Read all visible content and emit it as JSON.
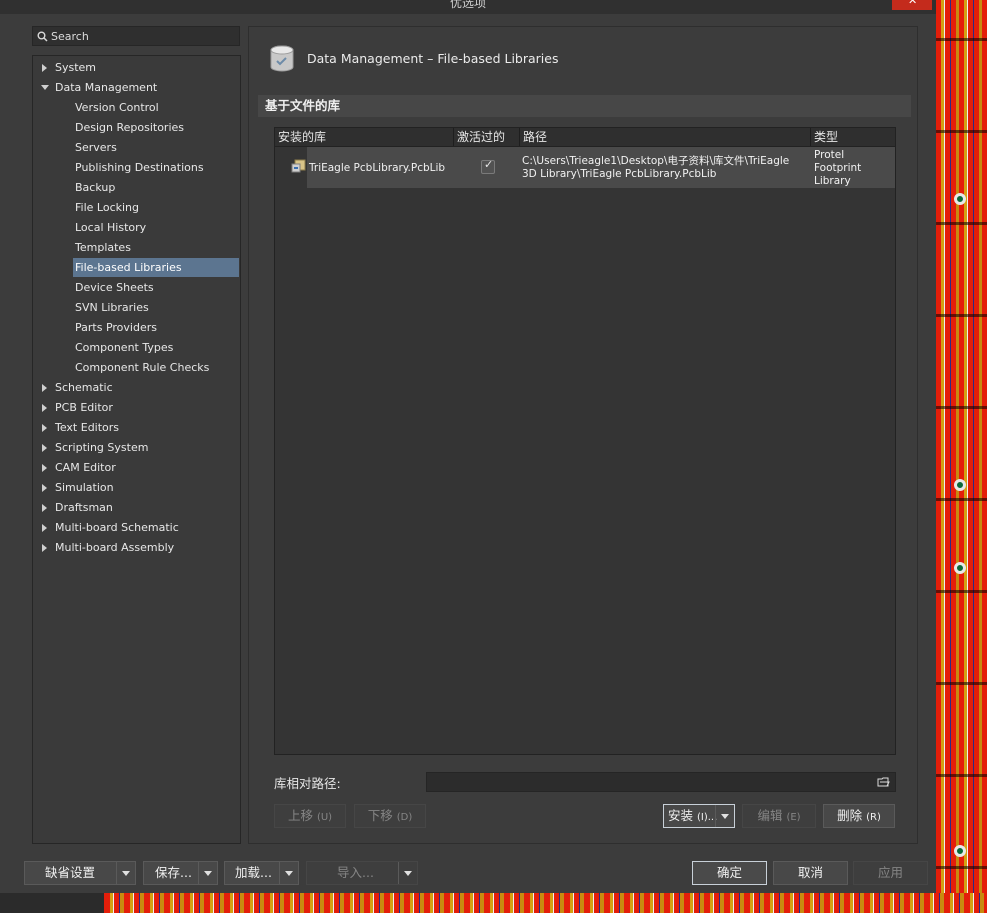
{
  "window": {
    "title": "优选项"
  },
  "search": {
    "placeholder": "Search"
  },
  "sidebar": {
    "items": [
      {
        "label": "System",
        "level": 0,
        "expanded": false,
        "selected": false
      },
      {
        "label": "Data Management",
        "level": 0,
        "expanded": true,
        "selected": false
      },
      {
        "label": "Version Control",
        "level": 1,
        "selected": false
      },
      {
        "label": "Design Repositories",
        "level": 1,
        "selected": false
      },
      {
        "label": "Servers",
        "level": 1,
        "selected": false
      },
      {
        "label": "Publishing Destinations",
        "level": 1,
        "selected": false
      },
      {
        "label": "Backup",
        "level": 1,
        "selected": false
      },
      {
        "label": "File Locking",
        "level": 1,
        "selected": false
      },
      {
        "label": "Local History",
        "level": 1,
        "selected": false
      },
      {
        "label": "Templates",
        "level": 1,
        "selected": false
      },
      {
        "label": "File-based Libraries",
        "level": 1,
        "selected": true
      },
      {
        "label": "Device Sheets",
        "level": 1,
        "selected": false
      },
      {
        "label": "SVN Libraries",
        "level": 1,
        "selected": false
      },
      {
        "label": "Parts Providers",
        "level": 1,
        "selected": false
      },
      {
        "label": "Component Types",
        "level": 1,
        "selected": false
      },
      {
        "label": "Component Rule Checks",
        "level": 1,
        "selected": false
      },
      {
        "label": "Schematic",
        "level": 0,
        "expanded": false,
        "selected": false
      },
      {
        "label": "PCB Editor",
        "level": 0,
        "expanded": false,
        "selected": false
      },
      {
        "label": "Text Editors",
        "level": 0,
        "expanded": false,
        "selected": false
      },
      {
        "label": "Scripting System",
        "level": 0,
        "expanded": false,
        "selected": false
      },
      {
        "label": "CAM Editor",
        "level": 0,
        "expanded": false,
        "selected": false
      },
      {
        "label": "Simulation",
        "level": 0,
        "expanded": false,
        "selected": false
      },
      {
        "label": "Draftsman",
        "level": 0,
        "expanded": false,
        "selected": false
      },
      {
        "label": "Multi-board Schematic",
        "level": 0,
        "expanded": false,
        "selected": false
      },
      {
        "label": "Multi-board Assembly",
        "level": 0,
        "expanded": false,
        "selected": false
      }
    ]
  },
  "page": {
    "title": "Data Management – File-based Libraries",
    "section": "基于文件的库"
  },
  "table": {
    "columns": [
      "安装的库",
      "激活过的",
      "路径",
      "类型"
    ],
    "rows": [
      {
        "name": "TriEagle PcbLibrary.PcbLib",
        "active": true,
        "path_line1": "C:\\Users\\Trieagle1\\Desktop\\电子资料\\库文件\\TriEagle",
        "path_line2": "3D Library\\TriEagle PcbLibrary.PcbLib",
        "type_line1": "Protel",
        "type_line2": "Footprint",
        "type_line3": "Library"
      }
    ]
  },
  "relative_path": {
    "label": "库相对路径:",
    "value": ""
  },
  "buttons": {
    "move_up": "上移",
    "move_up_key": "(U)",
    "move_down": "下移",
    "move_down_key": "(D)",
    "install": "安装",
    "install_key": "(I)...",
    "edit": "编辑",
    "edit_key": "(E)",
    "remove": "删除",
    "remove_key": "(R)",
    "defaults": "缺省设置",
    "save": "保存...",
    "load": "加载...",
    "import": "导入...",
    "ok": "确定",
    "cancel": "取消",
    "apply": "应用"
  },
  "colors": {
    "dialog_bg": "#3c3c3c",
    "selection": "#5c7590",
    "close": "#c42b1c"
  }
}
